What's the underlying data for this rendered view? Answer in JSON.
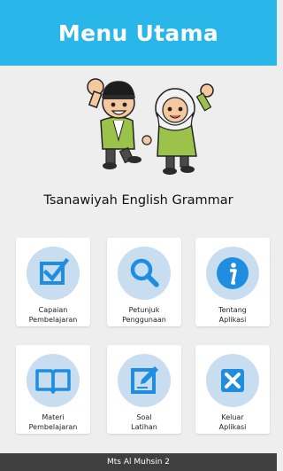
{
  "header": {
    "title": "Menu Utama"
  },
  "app_title": "Tsanawiyah English Grammar",
  "mascot": {
    "icon": "students-mascot-illustration"
  },
  "colors": {
    "header_bg": "#29b6e8",
    "icon_circle": "#c9ddf1",
    "icon_blue": "#1f8de0",
    "footer_bg": "#3f3f3f",
    "background": "#eeeeee"
  },
  "menu": [
    {
      "icon": "checkbox-icon",
      "line1": "Capaian",
      "line2": "Pembelajaran"
    },
    {
      "icon": "search-icon",
      "line1": "Petunjuk",
      "line2": "Penggunaan"
    },
    {
      "icon": "info-icon",
      "line1": "Tentang",
      "line2": "Aplikasi"
    },
    {
      "icon": "book-icon",
      "line1": "Materi",
      "line2": "Pembelajaran"
    },
    {
      "icon": "edit-icon",
      "line1": "Soal",
      "line2": "Latihan"
    },
    {
      "icon": "close-icon",
      "line1": "Keluar",
      "line2": "Aplikasi"
    }
  ],
  "footer": {
    "text": "Mts Al Muhsin 2"
  }
}
